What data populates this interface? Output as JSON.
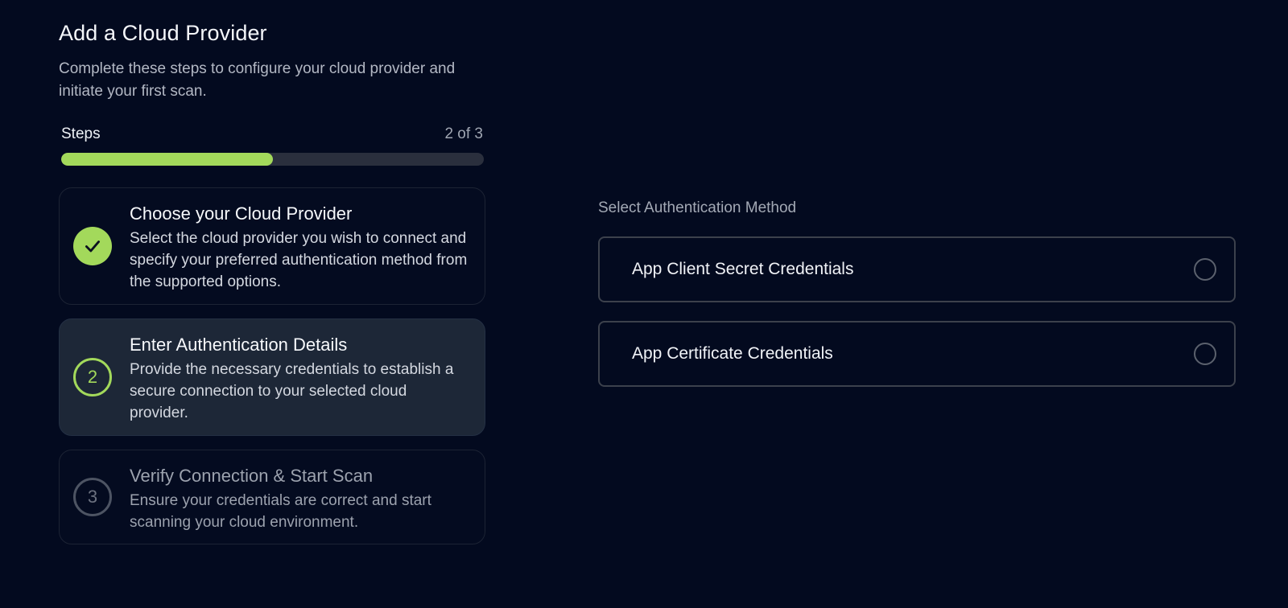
{
  "header": {
    "title": "Add a Cloud Provider",
    "subtitle": "Complete these steps to configure your cloud provider and initiate your first scan."
  },
  "progress": {
    "label": "Steps",
    "count_text": "2 of 3",
    "fraction": 0.5,
    "fill_color": "#a3d95b"
  },
  "steps": [
    {
      "status": "completed",
      "icon": "check-icon",
      "title": "Choose your Cloud Provider",
      "description": "Select the cloud provider you wish to connect and specify your preferred authentication method from the supported options."
    },
    {
      "status": "current",
      "number": "2",
      "title": "Enter Authentication Details",
      "description": "Provide the necessary credentials to establish a secure connection to your selected cloud provider."
    },
    {
      "status": "pending",
      "number": "3",
      "title": "Verify Connection & Start Scan",
      "description": "Ensure your credentials are correct and start scanning your cloud environment."
    }
  ],
  "auth": {
    "label": "Select Authentication Method",
    "options": [
      {
        "label": "App Client Secret Credentials",
        "selected": false
      },
      {
        "label": "App Certificate Credentials",
        "selected": false
      }
    ]
  },
  "colors": {
    "background": "#030a1f",
    "accent": "#a3d95b",
    "active_card": "#1d2737"
  }
}
